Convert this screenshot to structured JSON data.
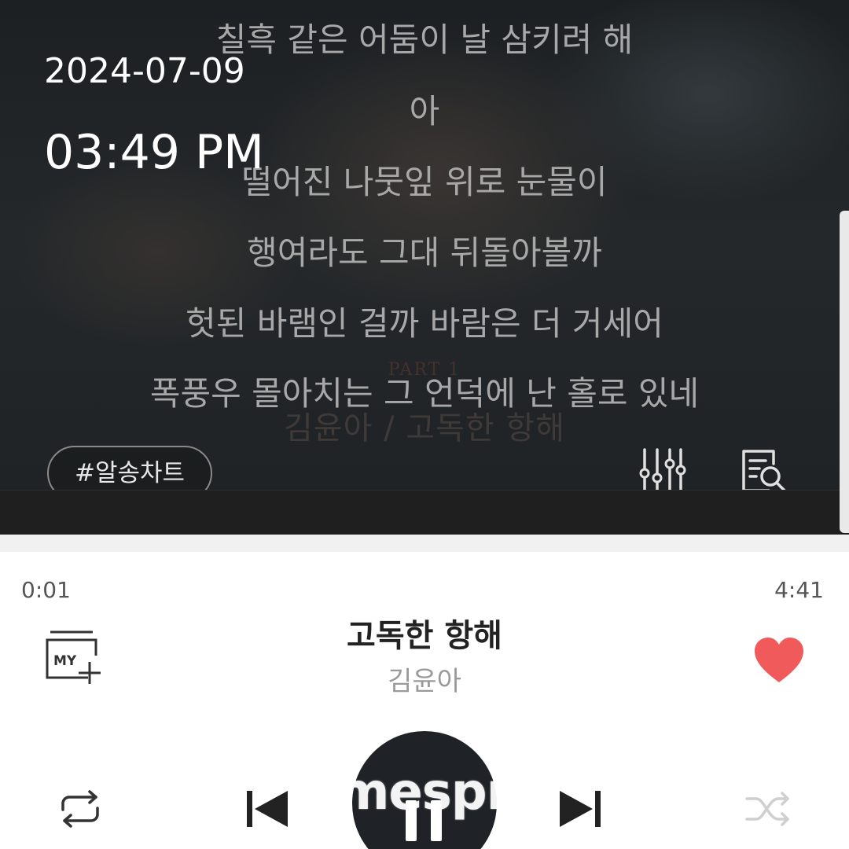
{
  "overlay": {
    "date": "2024-07-09",
    "time": "03:49 PM"
  },
  "lyrics": [
    "칠흑 같은 어둠이 날 삼키려 해",
    "아",
    "떨어진 나뭇잎 위로 눈물이",
    "행여라도 그대 뒤돌아볼까",
    "헛된 바램인 걸까 바람은 더 거세어",
    "폭풍우 몰아치는 그 언덕에 난 홀로 있네"
  ],
  "album_art_text": {
    "part": "PART 1",
    "caption": "김윤아 / 고독한 항해"
  },
  "tag_chip": "#알송차트",
  "player": {
    "elapsed": "0:01",
    "total": "4:41",
    "title": "고독한 항해",
    "artist": "김윤아",
    "my_add_label": "MY",
    "favorited": true,
    "heart_color": "#f05a5a"
  },
  "watermark": "imespro",
  "colors": {
    "lyric_text": "#a8a8a8",
    "play_button": "#1f2226",
    "title_text": "#222222",
    "artist_text": "#9a9a9a"
  },
  "icons": {
    "equalizer": "equalizer-icon",
    "lyrics_search": "lyrics-search-icon",
    "my_add": "add-to-my-list-icon",
    "heart": "heart-icon",
    "repeat": "repeat-icon",
    "previous": "previous-track-icon",
    "pause": "pause-icon",
    "next": "next-track-icon",
    "shuffle": "shuffle-icon"
  }
}
